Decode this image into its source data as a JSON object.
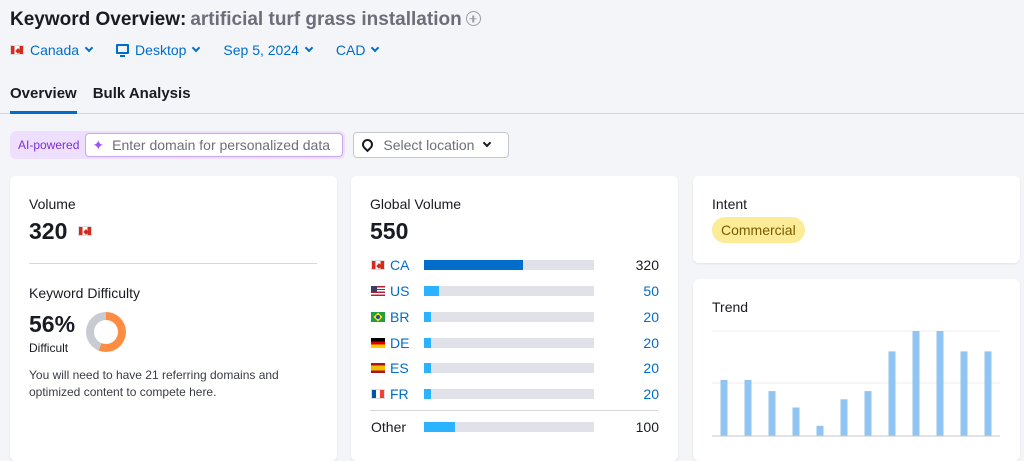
{
  "header": {
    "title": "Keyword Overview:",
    "keyword": "artificial turf grass installation",
    "filters": {
      "country": "Canada",
      "device": "Desktop",
      "date": "Sep 5, 2024",
      "currency": "CAD"
    },
    "tabs": [
      {
        "label": "Overview",
        "active": true
      },
      {
        "label": "Bulk Analysis",
        "active": false
      }
    ]
  },
  "toolbar": {
    "ai_label": "AI-powered",
    "domain_placeholder": "Enter domain for personalized data",
    "location_placeholder": "Select location"
  },
  "volume_card": {
    "volume_label": "Volume",
    "volume_value": "320",
    "kd_label": "Keyword Difficulty",
    "kd_value": "56%",
    "kd_percent": 56,
    "kd_level": "Difficult",
    "kd_description": "You will need to have 21 referring domains and optimized content to compete here.",
    "kd_color": "#ff8c43"
  },
  "global_volume_card": {
    "label": "Global Volume",
    "value": "550",
    "rows": [
      {
        "code": "CA",
        "flag": "flag-ca",
        "value": "320",
        "share": 0.58
      },
      {
        "code": "US",
        "flag": "flag-us",
        "value": "50",
        "share": 0.09
      },
      {
        "code": "BR",
        "flag": "flag-br",
        "value": "20",
        "share": 0.04
      },
      {
        "code": "DE",
        "flag": "flag-de",
        "value": "20",
        "share": 0.04
      },
      {
        "code": "ES",
        "flag": "flag-es",
        "value": "20",
        "share": 0.04
      },
      {
        "code": "FR",
        "flag": "flag-fr",
        "value": "20",
        "share": 0.04
      }
    ],
    "other": {
      "label": "Other",
      "value": "100",
      "share": 0.18
    },
    "colors": {
      "primary": "#006dca",
      "secondary": "#2bb3ff",
      "track": "#e0e1e9"
    }
  },
  "intent_card": {
    "label": "Intent",
    "badge": "Commercial",
    "badge_color": "#fcec98"
  },
  "trend_card": {
    "label": "Trend",
    "bar_color": "#8fc5f0",
    "values": [
      55,
      55,
      44,
      28,
      10,
      36,
      44,
      83,
      103,
      103,
      83,
      83
    ],
    "max": 103
  }
}
